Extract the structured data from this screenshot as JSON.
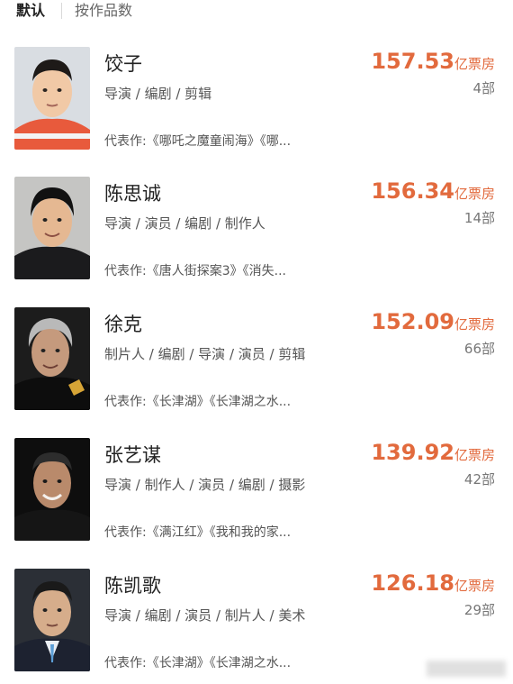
{
  "tabs": {
    "default_label": "默认",
    "by_works_label": "按作品数"
  },
  "box_office_unit": "亿票房",
  "list": [
    {
      "name": "饺子",
      "roles": "导演 / 编剧 / 剪辑",
      "box_office": "157.53",
      "works_count": "4部",
      "representative": "代表作:《哪吒之魔童闹海》《哪..."
    },
    {
      "name": "陈思诚",
      "roles": "导演 / 演员 / 编剧 / 制作人",
      "box_office": "156.34",
      "works_count": "14部",
      "representative": "代表作:《唐人街探案3》《消失..."
    },
    {
      "name": "徐克",
      "roles": "制片人 / 编剧 / 导演 / 演员 / 剪辑",
      "box_office": "152.09",
      "works_count": "66部",
      "representative": "代表作:《长津湖》《长津湖之水..."
    },
    {
      "name": "张艺谋",
      "roles": "导演 / 制作人 / 演员 / 编剧 / 摄影",
      "box_office": "139.92",
      "works_count": "42部",
      "representative": "代表作:《满江红》《我和我的家..."
    },
    {
      "name": "陈凯歌",
      "roles": "导演 / 编剧 / 演员 / 制片人 / 美术",
      "box_office": "126.18",
      "works_count": "29部",
      "representative": "代表作:《长津湖》《长津湖之水..."
    }
  ],
  "colors": {
    "accent": "#e26a3d",
    "text_primary": "#222222",
    "text_secondary": "#555555"
  }
}
